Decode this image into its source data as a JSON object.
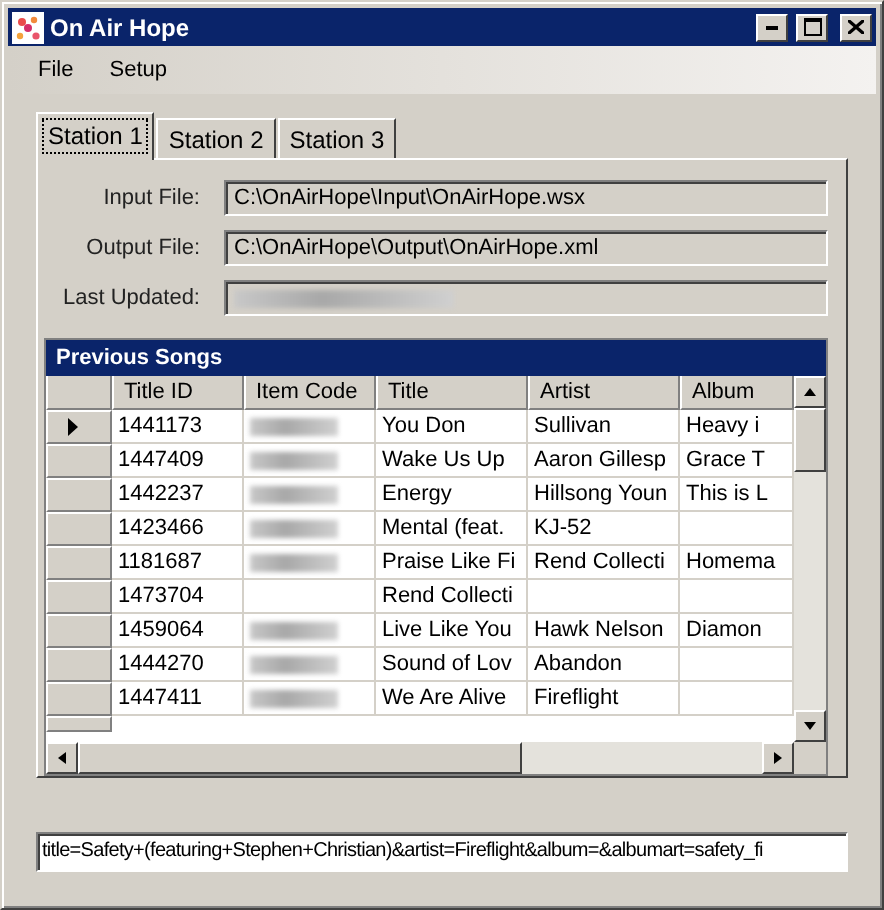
{
  "window": {
    "title": "On Air Hope"
  },
  "menu": [
    "File",
    "Setup"
  ],
  "tabs": [
    {
      "label": "Station 1",
      "selected": true
    },
    {
      "label": "Station 2",
      "selected": false
    },
    {
      "label": "Station 3",
      "selected": false
    }
  ],
  "fields": [
    {
      "label": "Input File:",
      "value": "C:\\OnAirHope\\Input\\OnAirHope.wsx",
      "redacted": false
    },
    {
      "label": "Output File:",
      "value": "C:\\OnAirHope\\Output\\OnAirHope.xml",
      "redacted": false
    },
    {
      "label": "Last Updated:",
      "redacted": true
    }
  ],
  "table": {
    "title": "Previous Songs",
    "columns": [
      "Title ID",
      "Item Code",
      "Title",
      "Artist",
      "Album"
    ],
    "rows": [
      {
        "selected": true,
        "item_code_redacted": true,
        "cells": [
          "1441173",
          "",
          "You Don",
          "Sullivan",
          "Heavy i"
        ]
      },
      {
        "selected": false,
        "item_code_redacted": true,
        "cells": [
          "1447409",
          "",
          "Wake Us Up",
          "Aaron Gillesp",
          "Grace T"
        ]
      },
      {
        "selected": false,
        "item_code_redacted": true,
        "cells": [
          "1442237",
          "",
          "Energy",
          "Hillsong Youn",
          "This is L"
        ]
      },
      {
        "selected": false,
        "item_code_redacted": true,
        "cells": [
          "1423466",
          "",
          "Mental (feat.",
          "KJ-52",
          ""
        ]
      },
      {
        "selected": false,
        "item_code_redacted": true,
        "cells": [
          "1181687",
          "",
          "Praise Like Fi",
          "Rend Collecti",
          "Homema"
        ]
      },
      {
        "selected": false,
        "item_code_redacted": false,
        "cells": [
          "1473704",
          "",
          "Rend Collecti",
          "",
          ""
        ]
      },
      {
        "selected": false,
        "item_code_redacted": true,
        "cells": [
          "1459064",
          "",
          "Live Like You",
          "Hawk Nelson",
          "Diamon"
        ]
      },
      {
        "selected": false,
        "item_code_redacted": true,
        "cells": [
          "1444270",
          "",
          "Sound of Lov",
          "Abandon",
          ""
        ]
      },
      {
        "selected": false,
        "item_code_redacted": true,
        "cells": [
          "1447411",
          "",
          "We Are Alive",
          "Fireflight",
          ""
        ]
      }
    ]
  },
  "output": {
    "value": "title=Safety+(featuring+Stephen+Christian)&artist=Fireflight&album=&albumart=safety_fi"
  }
}
